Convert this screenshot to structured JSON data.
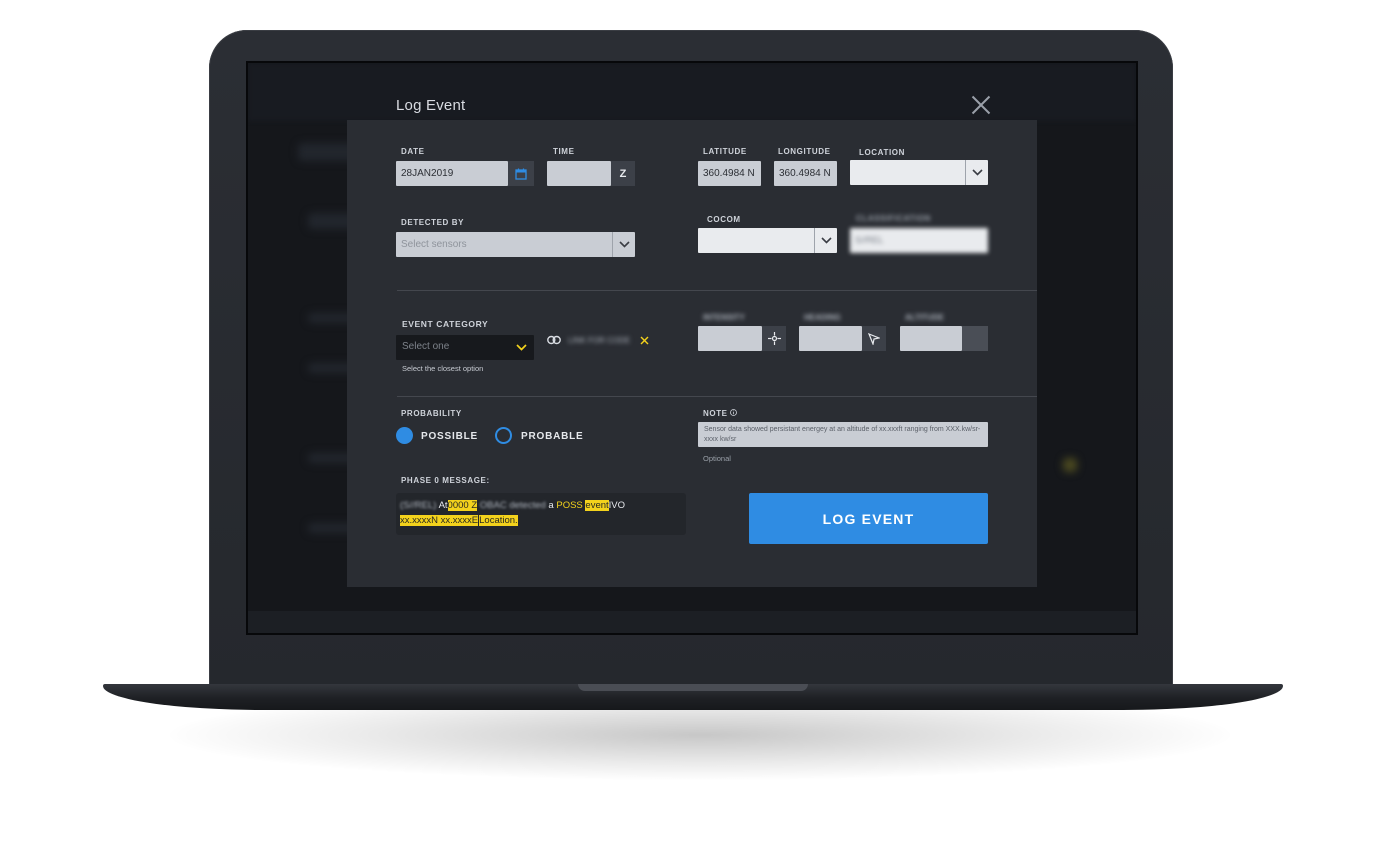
{
  "modal": {
    "title": "Log Event"
  },
  "fields": {
    "date": {
      "label": "DATE",
      "value": "28JAN2019"
    },
    "time": {
      "label": "TIME",
      "value": "",
      "suffix": "Z"
    },
    "latitude": {
      "label": "LATITUDE",
      "value": "360.4984 N"
    },
    "longitude": {
      "label": "LONGITUDE",
      "value": "360.4984 N"
    },
    "location": {
      "label": "LOCATION",
      "value": ""
    },
    "detected_by": {
      "label": "DETECTED BY",
      "placeholder": "Select sensors"
    },
    "cocom": {
      "label": "COCOM",
      "value": ""
    },
    "classification": {
      "label": "CLASSIFICATION",
      "value": "S//REL"
    },
    "event_category": {
      "label": "EVENT CATEGORY",
      "placeholder": "Select one",
      "hint": "Select the closest option",
      "link_text": "LINK FOR CODE"
    },
    "intensity": {
      "label": "INTENSITY"
    },
    "heading": {
      "label": "HEADING"
    },
    "altitude": {
      "label": "ALTITUDE"
    },
    "probability": {
      "label": "PROBABILITY",
      "options": [
        {
          "label": "POSSIBLE",
          "selected": true
        },
        {
          "label": "PROBABLE",
          "selected": false
        }
      ]
    },
    "note": {
      "label": "NOTE",
      "value": "Sensor data showed persistant energey at  an altitude of xx.xxxft ranging from XXX.kw/sr-xxxx kw/sr",
      "hint": "Optional"
    }
  },
  "phase_message": {
    "label": "PHASE 0 MESSAGE:",
    "parts": {
      "classification": "(S//REL)",
      "at": "At",
      "time": "0000 Z",
      "sensor": "OBAC detected",
      "a": "a",
      "poss": "POSS",
      "event": "event",
      "ivo": "IVO",
      "coords": "xx.xxxxN xx.xxxxE",
      "location": "Location."
    }
  },
  "actions": {
    "log_event": "LOG EVENT"
  },
  "colors": {
    "accent": "#2f8ce3",
    "highlight": "#f3d21c",
    "modal_bg": "#2a2d33"
  }
}
